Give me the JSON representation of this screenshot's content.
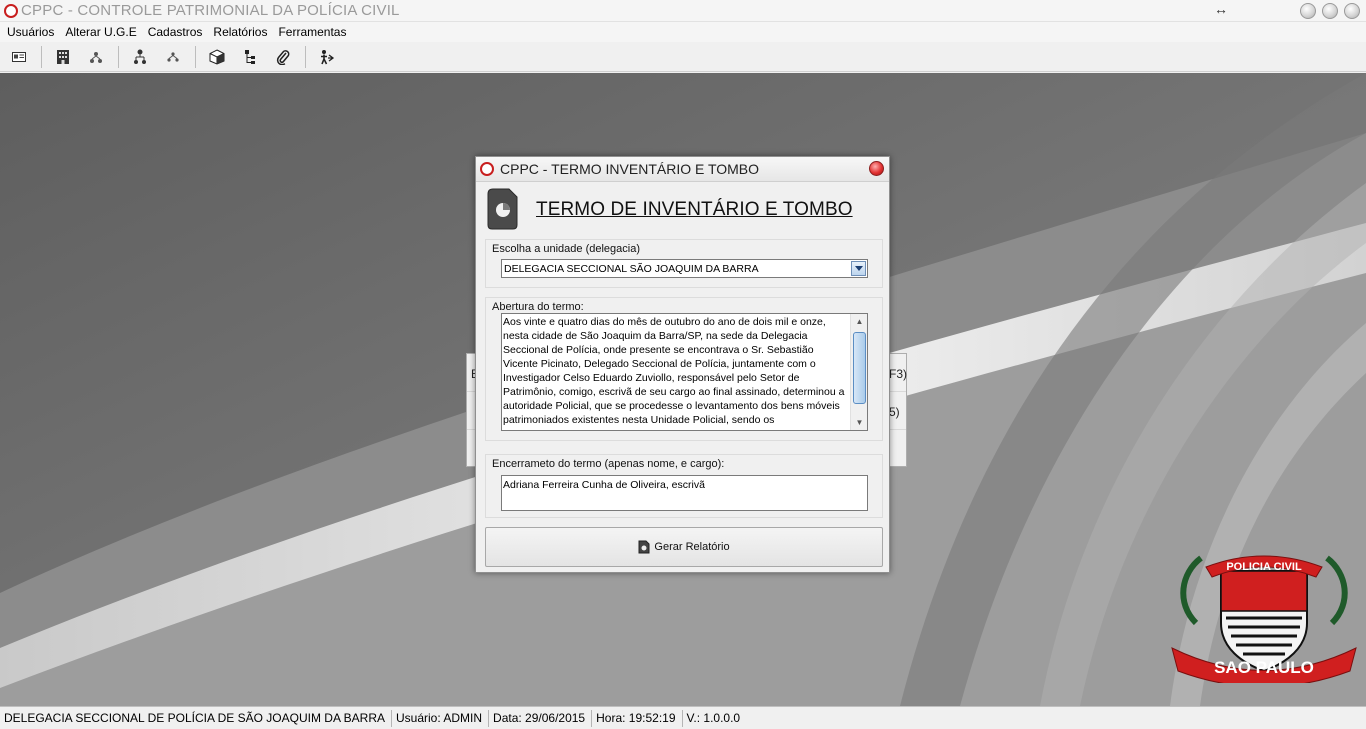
{
  "app": {
    "title": "CPPC - CONTROLE PATRIMONIAL DA POLÍCIA CIVIL",
    "resize_glyph": "↔"
  },
  "menu": {
    "items": [
      "Usuários",
      "Alterar U.G.E",
      "Cadastros",
      "Relatórios",
      "Ferramentas"
    ]
  },
  "toolbar": {
    "buttons": [
      "id-card-icon",
      "building-icon",
      "network-icon",
      "user-hierarchy-icon",
      "network-small-icon",
      "box-icon",
      "tree-icon",
      "paperclip-icon",
      "exit-user-icon"
    ]
  },
  "behind_window": {
    "row1_left": "E",
    "row1_right": "F3)",
    "row2_right": "5)"
  },
  "dialog": {
    "title": "CPPC - TERMO INVENTÁRIO E TOMBO",
    "heading": "TERMO DE INVENTÁRIO E TOMBO",
    "unit_group_label": "Escolha a unidade (delegacia)",
    "unit_selected": "DELEGACIA SECCIONAL SÃO JOAQUIM DA BARRA",
    "opening_group_label": "Abertura do termo:",
    "opening_text": "Aos vinte e quatro dias do mês de outubro do ano de dois mil e onze, nesta cidade de São Joaquim da Barra/SP, na sede da Delegacia Seccional de Polícia, onde presente se encontrava o Sr. Sebastião Vicente Picinato, Delegado Seccional de Polícia, juntamente com o Investigador Celso Eduardo Zuviollo, responsável pelo Setor de Patrimônio, comigo, escrivã de seu cargo ao final assinado, determinou a autoridade Policial, que se procedesse o levantamento dos bens móveis patrimoniados existentes nesta Unidade Policial, sendo os",
    "closing_group_label": "Encerrameto do termo (apenas nome, e cargo):",
    "closing_value": "Adriana Ferreira Cunha de Oliveira, escrivã",
    "generate_button": "Gerar Relatório"
  },
  "emblem": {
    "top_text": "POLICIA CIVIL",
    "bottom_text": "SAO PAULO"
  },
  "status": {
    "unit": "DELEGACIA SECCIONAL DE POLÍCIA DE SÃO JOAQUIM DA BARRA",
    "user": "Usuário: ADMIN",
    "date": "Data: 29/06/2015",
    "time": "Hora: 19:52:19",
    "version": "V.: 1.0.0.0"
  },
  "colors": {
    "accent_red": "#c81e1e",
    "scroll_blue": "#5b8ec4"
  }
}
